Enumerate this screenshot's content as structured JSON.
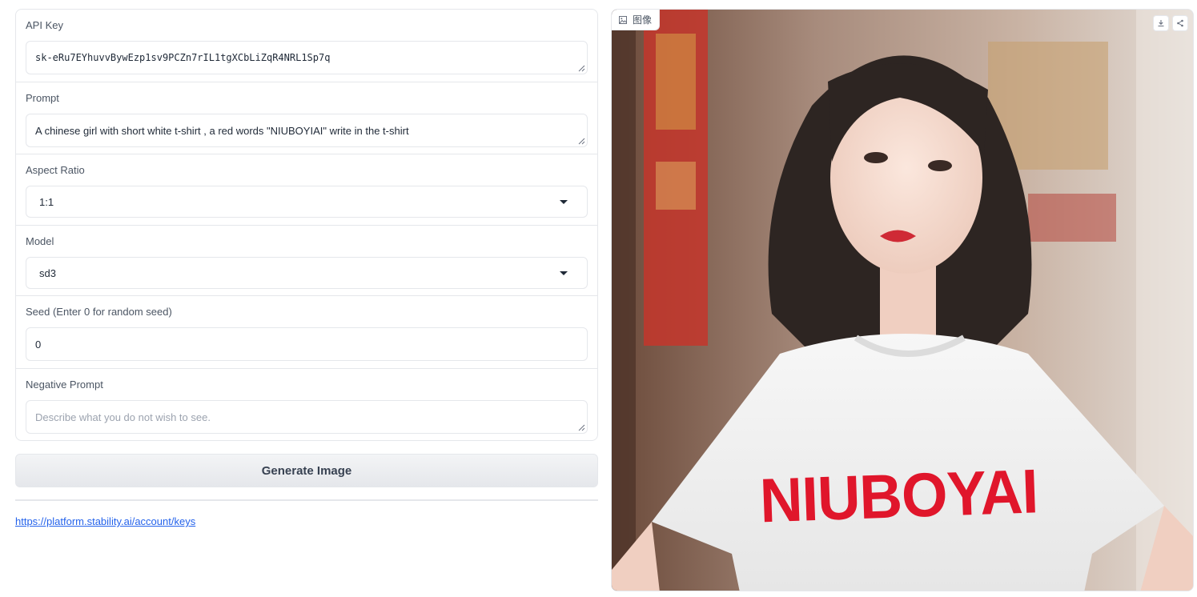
{
  "form": {
    "api_key": {
      "label": "API Key",
      "value": "sk-eRu7EYhuvvBywEzp1sv9PCZn7rIL1tgXCbLiZqR4NRL1Sp7q"
    },
    "prompt": {
      "label": "Prompt",
      "value": "A chinese girl with short white t-shirt , a red words \"NIUBOYIAI\" write in the t-shirt"
    },
    "aspect_ratio": {
      "label": "Aspect Ratio",
      "value": "1:1"
    },
    "model": {
      "label": "Model",
      "value": "sd3"
    },
    "seed": {
      "label": "Seed (Enter 0 for random seed)",
      "value": "0"
    },
    "negative_prompt": {
      "label": "Negative Prompt",
      "value": "",
      "placeholder": "Describe what you do not wish to see."
    }
  },
  "generate_button": {
    "label": "Generate Image"
  },
  "link": {
    "text": "https://platform.stability.ai/account/keys"
  },
  "image_output": {
    "label": "图像",
    "shirt_text": "NIUBOYAI",
    "icons": [
      "image-icon",
      "download-icon",
      "share-icon"
    ]
  },
  "colors": {
    "accent_link": "#2563eb",
    "shirt_text": "#e0162b"
  }
}
